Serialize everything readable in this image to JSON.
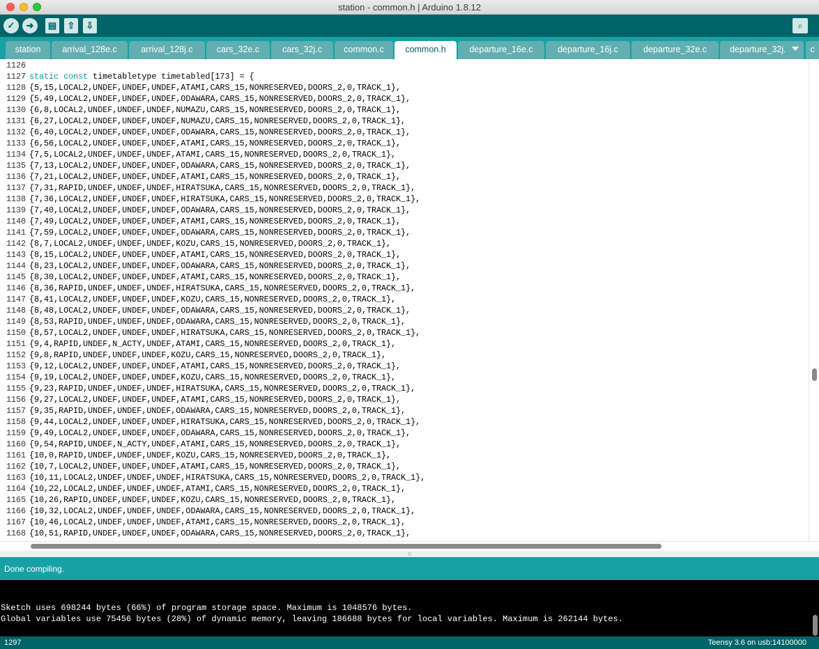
{
  "window": {
    "title": "station - common.h | Arduino 1.8.12"
  },
  "toolbar": {
    "buttons": [
      {
        "name": "verify",
        "icon": "check-icon",
        "glyph": "✓"
      },
      {
        "name": "upload",
        "icon": "arrow-right-icon",
        "glyph": "➜"
      },
      {
        "name": "new",
        "icon": "file-icon",
        "glyph": "▤"
      },
      {
        "name": "open",
        "icon": "arrow-up-icon",
        "glyph": "⇧"
      },
      {
        "name": "save",
        "icon": "arrow-down-icon",
        "glyph": "⇩"
      }
    ],
    "serial_monitor_glyph": "⌕"
  },
  "tabs": [
    {
      "label": "station",
      "active": false
    },
    {
      "label": "arrival_128e.c",
      "active": false
    },
    {
      "label": "arrival_128j.c",
      "active": false
    },
    {
      "label": "cars_32e.c",
      "active": false
    },
    {
      "label": "cars_32j.c",
      "active": false
    },
    {
      "label": "common.c",
      "active": false
    },
    {
      "label": "common.h",
      "active": true
    },
    {
      "label": "departure_16e.c",
      "active": false
    },
    {
      "label": "departure_16j.c",
      "active": false
    },
    {
      "label": "departure_32e.c",
      "active": false
    },
    {
      "label": "departure_32j.",
      "active": false
    },
    {
      "label": "c",
      "active": false
    }
  ],
  "editor": {
    "lines": [
      {
        "n": "1126",
        "code": ""
      },
      {
        "n": "1127",
        "code": "static const timetabletype timetabled[173] = {"
      },
      {
        "n": "1128",
        "code": "{5,15,LOCAL2,UNDEF,UNDEF,UNDEF,ATAMI,CARS_15,NONRESERVED,DOORS_2,0,TRACK_1},"
      },
      {
        "n": "1129",
        "code": "{5,49,LOCAL2,UNDEF,UNDEF,UNDEF,ODAWARA,CARS_15,NONRESERVED,DOORS_2,0,TRACK_1},"
      },
      {
        "n": "1130",
        "code": "{6,8,LOCAL2,UNDEF,UNDEF,UNDEF,NUMAZU,CARS_15,NONRESERVED,DOORS_2,0,TRACK_1},"
      },
      {
        "n": "1131",
        "code": "{6,27,LOCAL2,UNDEF,UNDEF,UNDEF,NUMAZU,CARS_15,NONRESERVED,DOORS_2,0,TRACK_1},"
      },
      {
        "n": "1132",
        "code": "{6,40,LOCAL2,UNDEF,UNDEF,UNDEF,ODAWARA,CARS_15,NONRESERVED,DOORS_2,0,TRACK_1},"
      },
      {
        "n": "1133",
        "code": "{6,56,LOCAL2,UNDEF,UNDEF,UNDEF,ATAMI,CARS_15,NONRESERVED,DOORS_2,0,TRACK_1},"
      },
      {
        "n": "1134",
        "code": "{7,5,LOCAL2,UNDEF,UNDEF,UNDEF,ATAMI,CARS_15,NONRESERVED,DOORS_2,0,TRACK_1},"
      },
      {
        "n": "1135",
        "code": "{7,13,LOCAL2,UNDEF,UNDEF,UNDEF,ODAWARA,CARS_15,NONRESERVED,DOORS_2,0,TRACK_1},"
      },
      {
        "n": "1136",
        "code": "{7,21,LOCAL2,UNDEF,UNDEF,UNDEF,ATAMI,CARS_15,NONRESERVED,DOORS_2,0,TRACK_1},"
      },
      {
        "n": "1137",
        "code": "{7,31,RAPID,UNDEF,UNDEF,UNDEF,HIRATSUKA,CARS_15,NONRESERVED,DOORS_2,0,TRACK_1},"
      },
      {
        "n": "1138",
        "code": "{7,36,LOCAL2,UNDEF,UNDEF,UNDEF,HIRATSUKA,CARS_15,NONRESERVED,DOORS_2,0,TRACK_1},"
      },
      {
        "n": "1139",
        "code": "{7,40,LOCAL2,UNDEF,UNDEF,UNDEF,ODAWARA,CARS_15,NONRESERVED,DOORS_2,0,TRACK_1},"
      },
      {
        "n": "1140",
        "code": "{7,49,LOCAL2,UNDEF,UNDEF,UNDEF,ATAMI,CARS_15,NONRESERVED,DOORS_2,0,TRACK_1},"
      },
      {
        "n": "1141",
        "code": "{7,59,LOCAL2,UNDEF,UNDEF,UNDEF,ODAWARA,CARS_15,NONRESERVED,DOORS_2,0,TRACK_1},"
      },
      {
        "n": "1142",
        "code": "{8,7,LOCAL2,UNDEF,UNDEF,UNDEF,KOZU,CARS_15,NONRESERVED,DOORS_2,0,TRACK_1},"
      },
      {
        "n": "1143",
        "code": "{8,15,LOCAL2,UNDEF,UNDEF,UNDEF,ATAMI,CARS_15,NONRESERVED,DOORS_2,0,TRACK_1},"
      },
      {
        "n": "1144",
        "code": "{8,23,LOCAL2,UNDEF,UNDEF,UNDEF,ODAWARA,CARS_15,NONRESERVED,DOORS_2,0,TRACK_1},"
      },
      {
        "n": "1145",
        "code": "{8,30,LOCAL2,UNDEF,UNDEF,UNDEF,ATAMI,CARS_15,NONRESERVED,DOORS_2,0,TRACK_1},"
      },
      {
        "n": "1146",
        "code": "{8,36,RAPID,UNDEF,UNDEF,UNDEF,HIRATSUKA,CARS_15,NONRESERVED,DOORS_2,0,TRACK_1},"
      },
      {
        "n": "1147",
        "code": "{8,41,LOCAL2,UNDEF,UNDEF,UNDEF,KOZU,CARS_15,NONRESERVED,DOORS_2,0,TRACK_1},"
      },
      {
        "n": "1148",
        "code": "{8,48,LOCAL2,UNDEF,UNDEF,UNDEF,ODAWARA,CARS_15,NONRESERVED,DOORS_2,0,TRACK_1},"
      },
      {
        "n": "1149",
        "code": "{8,53,RAPID,UNDEF,UNDEF,UNDEF,ODAWARA,CARS_15,NONRESERVED,DOORS_2,0,TRACK_1},"
      },
      {
        "n": "1150",
        "code": "{8,57,LOCAL2,UNDEF,UNDEF,UNDEF,HIRATSUKA,CARS_15,NONRESERVED,DOORS_2,0,TRACK_1},"
      },
      {
        "n": "1151",
        "code": "{9,4,RAPID,UNDEF,N_ACTY,UNDEF,ATAMI,CARS_15,NONRESERVED,DOORS_2,0,TRACK_1},"
      },
      {
        "n": "1152",
        "code": "{9,8,RAPID,UNDEF,UNDEF,UNDEF,KOZU,CARS_15,NONRESERVED,DOORS_2,0,TRACK_1},"
      },
      {
        "n": "1153",
        "code": "{9,12,LOCAL2,UNDEF,UNDEF,UNDEF,ATAMI,CARS_15,NONRESERVED,DOORS_2,0,TRACK_1},"
      },
      {
        "n": "1154",
        "code": "{9,19,LOCAL2,UNDEF,UNDEF,UNDEF,KOZU,CARS_15,NONRESERVED,DOORS_2,0,TRACK_1},"
      },
      {
        "n": "1155",
        "code": "{9,23,RAPID,UNDEF,UNDEF,UNDEF,HIRATSUKA,CARS_15,NONRESERVED,DOORS_2,0,TRACK_1},"
      },
      {
        "n": "1156",
        "code": "{9,27,LOCAL2,UNDEF,UNDEF,UNDEF,ATAMI,CARS_15,NONRESERVED,DOORS_2,0,TRACK_1},"
      },
      {
        "n": "1157",
        "code": "{9,35,RAPID,UNDEF,UNDEF,UNDEF,ODAWARA,CARS_15,NONRESERVED,DOORS_2,0,TRACK_1},"
      },
      {
        "n": "1158",
        "code": "{9,44,LOCAL2,UNDEF,UNDEF,UNDEF,HIRATSUKA,CARS_15,NONRESERVED,DOORS_2,0,TRACK_1},"
      },
      {
        "n": "1159",
        "code": "{9,49,LOCAL2,UNDEF,UNDEF,UNDEF,ODAWARA,CARS_15,NONRESERVED,DOORS_2,0,TRACK_1},"
      },
      {
        "n": "1160",
        "code": "{9,54,RAPID,UNDEF,N_ACTY,UNDEF,ATAMI,CARS_15,NONRESERVED,DOORS_2,0,TRACK_1},"
      },
      {
        "n": "1161",
        "code": "{10,0,RAPID,UNDEF,UNDEF,UNDEF,KOZU,CARS_15,NONRESERVED,DOORS_2,0,TRACK_1},"
      },
      {
        "n": "1162",
        "code": "{10,7,LOCAL2,UNDEF,UNDEF,UNDEF,ATAMI,CARS_15,NONRESERVED,DOORS_2,0,TRACK_1},"
      },
      {
        "n": "1163",
        "code": "{10,11,LOCAL2,UNDEF,UNDEF,UNDEF,HIRATSUKA,CARS_15,NONRESERVED,DOORS_2,0,TRACK_1},"
      },
      {
        "n": "1164",
        "code": "{10,22,LOCAL2,UNDEF,UNDEF,UNDEF,ATAMI,CARS_15,NONRESERVED,DOORS_2,0,TRACK_1},"
      },
      {
        "n": "1165",
        "code": "{10,26,RAPID,UNDEF,UNDEF,UNDEF,KOZU,CARS_15,NONRESERVED,DOORS_2,0,TRACK_1},"
      },
      {
        "n": "1166",
        "code": "{10,32,LOCAL2,UNDEF,UNDEF,UNDEF,ODAWARA,CARS_15,NONRESERVED,DOORS_2,0,TRACK_1},"
      },
      {
        "n": "1167",
        "code": "{10,46,LOCAL2,UNDEF,UNDEF,UNDEF,ATAMI,CARS_15,NONRESERVED,DOORS_2,0,TRACK_1},"
      },
      {
        "n": "1168",
        "code": "{10,51,RAPID,UNDEF,UNDEF,UNDEF,ODAWARA,CARS_15,NONRESERVED,DOORS_2,0,TRACK_1},"
      }
    ]
  },
  "status": {
    "message": "Done compiling."
  },
  "console": {
    "lines": [
      "Sketch uses 698244 bytes (66%) of program storage space. Maximum is 1048576 bytes.",
      "Global variables use 75456 bytes (28%) of dynamic memory, leaving 186688 bytes for local variables. Maximum is 262144 bytes."
    ]
  },
  "footer": {
    "line_number": "1297",
    "board": "Teensy 3.6 on usb:14100000"
  },
  "colors": {
    "toolbar": "#006468",
    "tabbar": "#17a1a5",
    "keyword": "#00979c"
  }
}
